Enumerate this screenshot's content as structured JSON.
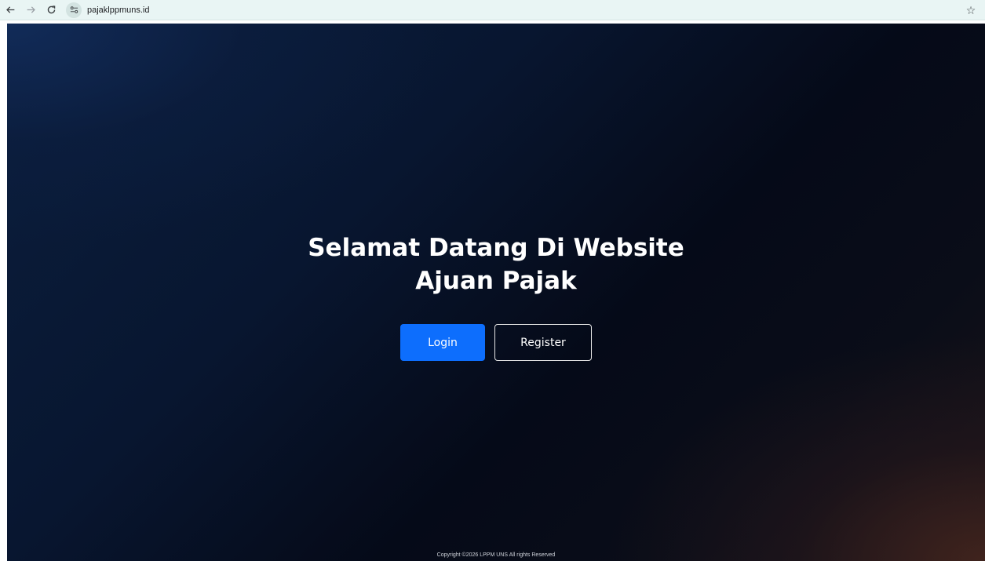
{
  "browser": {
    "url": "pajaklppmuns.id",
    "icons": {
      "back": "arrow-left-icon",
      "forward": "arrow-right-icon",
      "reload": "reload-icon",
      "site_info": "tune-icon",
      "bookmark": "star-icon"
    }
  },
  "hero": {
    "title_line1": "Selamat Datang Di Website",
    "title_line2": "Ajuan Pajak"
  },
  "actions": {
    "login_label": "Login",
    "register_label": "Register"
  },
  "footer": {
    "copyright": "Copyright ©2026 LPPM UNS All rights Reserved"
  },
  "colors": {
    "primary_button": "#0d6efd",
    "browser_bar": "#e9f5f4",
    "page_background": "#081630"
  }
}
